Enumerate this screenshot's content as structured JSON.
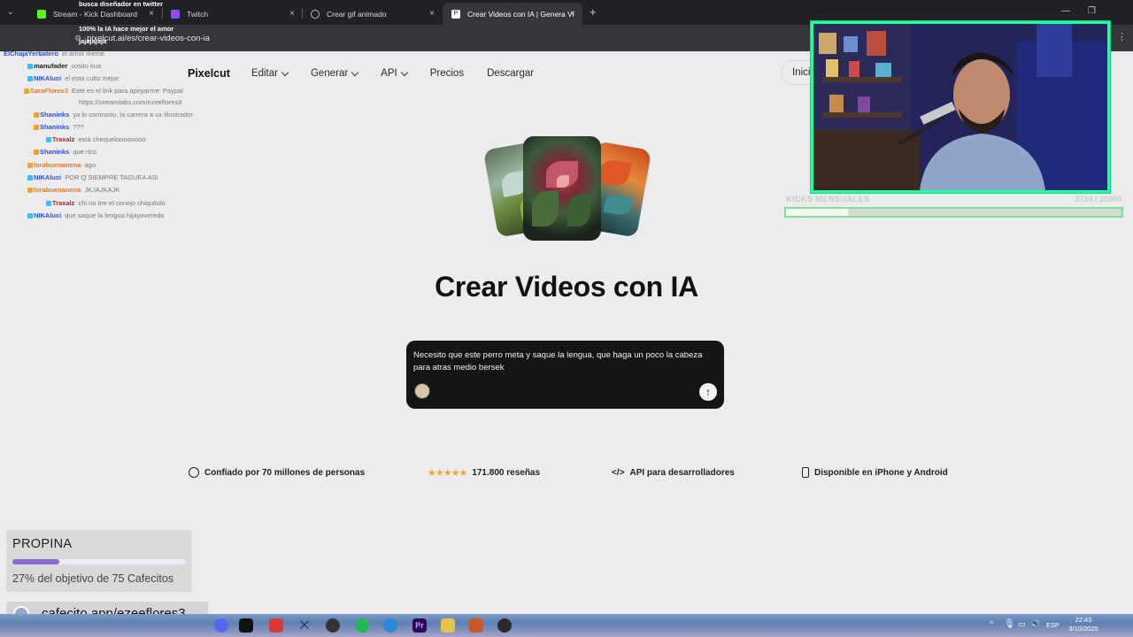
{
  "browser": {
    "tabs": [
      {
        "title": "Stream - Kick Dashboard",
        "close": "×"
      },
      {
        "title": "Twitch",
        "close": "×"
      },
      {
        "title": "Crear gif animado",
        "close": "×"
      },
      {
        "title": "Crear Videos con IA | Genera Vi",
        "close": "×"
      }
    ],
    "new_tab": "+",
    "url": "pixelcut.ai/es/crear-videos-con-ia"
  },
  "site": {
    "logo": "Pixelcut",
    "nav": [
      "Editar",
      "Generar",
      "API",
      "Precios",
      "Descargar"
    ],
    "inicio": "Inici",
    "headline": "Crear Videos con IA",
    "prompt": "Necesito que este perro meta y saque la lengua, que haga un poco la cabeza para atras medio bersek",
    "send": "↑",
    "features": [
      {
        "icon": "smiley-icon",
        "label": "Confiado por 70 millones de personas"
      },
      {
        "icon": "stars-icon",
        "stars": "★★★★★",
        "label": "171.800 reseñas"
      },
      {
        "icon": "code-icon",
        "glyph": "</>",
        "label": "API para desarrolladores"
      },
      {
        "icon": "phone-icon",
        "label": "Disponible en iPhone y Android"
      }
    ]
  },
  "chat": [
    {
      "user": "",
      "msg": "busca diseñador en twitter"
    },
    {
      "user": "",
      "msg": "100% la IA hace mejor el amor"
    },
    {
      "user": "",
      "msg": "jajajajaja"
    },
    {
      "user": "ElChajaYerbatero",
      "msg": "el amor meme"
    },
    {
      "user": "manufader",
      "msg": "sosito kua"
    },
    {
      "user": "NIKAluci",
      "msg": "el esta culto mejor"
    },
    {
      "user": "SaraFlores3",
      "msg": "Este es el link para apoyarme: Paypal"
    },
    {
      "user": "",
      "msg": "https://streamlabs.com/ezeeflores3"
    },
    {
      "user": "Shaninks",
      "msg": "ya lo contrasto, la carrera a ux illustrador"
    },
    {
      "user": "Shaninks",
      "msg": "???"
    },
    {
      "user": "Traxalz",
      "msg": "está chequeloooooooo"
    },
    {
      "user": "Shaninks",
      "msg": "que rico"
    },
    {
      "user": "lorabuenanena",
      "msg": "ago"
    },
    {
      "user": "NIKAluci",
      "msg": "POR Q SIEMPRE TAGUEA ASI"
    },
    {
      "user": "lorabuenanena",
      "msg": "JKJAJKAJK"
    },
    {
      "user": "Traxalz",
      "msg": "chi no tire el conejo chiquitolo"
    },
    {
      "user": "NIKAluci",
      "msg": "que saque la lengua hijayoveredo"
    }
  ],
  "kicks": {
    "label": "KICKS MENSUALES",
    "count": "3724 / 20000",
    "progress": 0.186
  },
  "propina": {
    "title": "PROPINA",
    "progress": 0.27,
    "goal": "27% del objetivo de 75 Cafecitos",
    "link": "cafecito.app/ezeeflores3"
  },
  "taskbar": {
    "lang": "ESP",
    "time": "22:43",
    "date": "3/10/2025",
    "colors": {
      "accent": "#22ff9c",
      "propina_fill": "#8e6cd4"
    }
  }
}
